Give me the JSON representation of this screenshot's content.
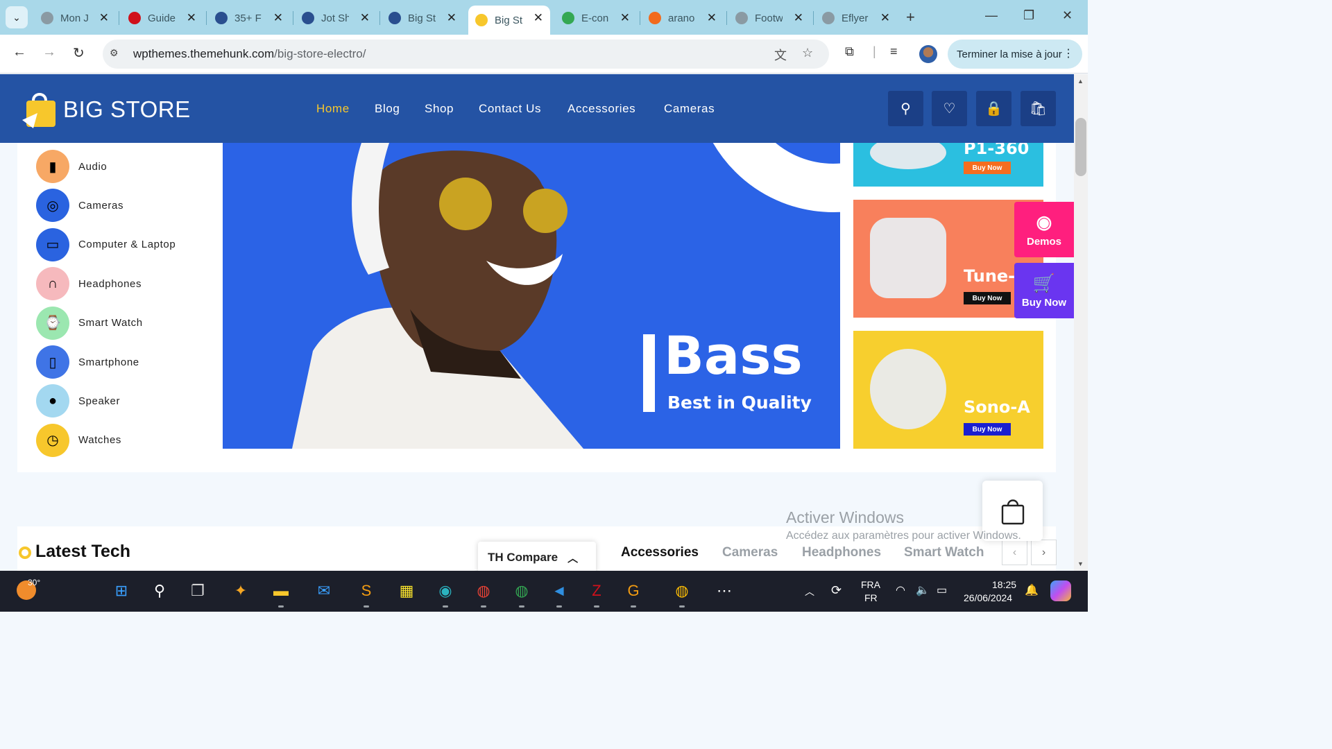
{
  "browser": {
    "tabs": [
      {
        "title": "Mon J",
        "icon": "globe-icon",
        "color": "#8a9aa3"
      },
      {
        "title": "Guide",
        "icon": "opera-icon",
        "color": "#d0111b"
      },
      {
        "title": "35+ F",
        "icon": "themehunk-icon",
        "color": "#2a4f8f"
      },
      {
        "title": "Jot Sh",
        "icon": "themehunk-icon",
        "color": "#2a4f8f"
      },
      {
        "title": "Big St",
        "icon": "themehunk-icon",
        "color": "#2a4f8f"
      },
      {
        "title": "Big St",
        "icon": "bigstore-icon",
        "color": "#f7c72c",
        "active": true
      },
      {
        "title": "E-con",
        "icon": "leaf-icon",
        "color": "#34a853"
      },
      {
        "title": "arano",
        "icon": "spiral-icon",
        "color": "#f26b1d"
      },
      {
        "title": "Footw",
        "icon": "globe-icon",
        "color": "#8a9aa3"
      },
      {
        "title": "Eflyer",
        "icon": "globe-icon",
        "color": "#8a9aa3"
      }
    ],
    "url_host": "wpthemes.themehunk.com",
    "url_path": "/big-store-electro/",
    "update_label": "Terminer la mise à jour"
  },
  "site": {
    "logo": "BIG STORE",
    "menu": [
      "Home",
      "Blog",
      "Shop",
      "Contact Us",
      "Accessories",
      "Cameras"
    ],
    "categories": [
      {
        "label": "Audio",
        "icon": "speaker-tower-icon",
        "bg": "#f7a865"
      },
      {
        "label": "Cameras",
        "icon": "camera-icon",
        "bg": "#2a63e0"
      },
      {
        "label": "Computer & Laptop",
        "icon": "laptop-icon",
        "bg": "#2a63e0"
      },
      {
        "label": "Headphones",
        "icon": "headphones-icon",
        "bg": "#f6b9bd"
      },
      {
        "label": "Smart Watch",
        "icon": "smartwatch-icon",
        "bg": "#9be7b0"
      },
      {
        "label": "Smartphone",
        "icon": "smartphone-icon",
        "bg": "#3f74e6"
      },
      {
        "label": "Speaker",
        "icon": "speaker-icon",
        "bg": "#a3d8f0"
      },
      {
        "label": "Watches",
        "icon": "watch-icon",
        "bg": "#f7c72c"
      }
    ],
    "hero": {
      "headline": "Bass",
      "subline": "Best in Quality"
    },
    "side_banners": [
      {
        "name": "P1-360",
        "button": "Buy Now",
        "bg": "#2bbfe0",
        "btn_bg": "#f56d1f"
      },
      {
        "name": "Tune-",
        "button": "Buy Now",
        "bg": "#f8805c",
        "btn_bg": "#111111"
      },
      {
        "name": "Sono-A",
        "button": "Buy Now",
        "bg": "#f7cf2e",
        "btn_bg": "#1a1fd0"
      }
    ],
    "float_demos": "Demos",
    "float_buy": "Buy Now",
    "latest_title": "Latest Tech",
    "compare_label": "TH Compare",
    "product_tabs": [
      "Accessories",
      "Cameras",
      "Headphones",
      "Smart Watch"
    ],
    "activate_title": "Activer Windows",
    "activate_sub": "Accédez aux paramètres pour activer Windows."
  },
  "taskbar": {
    "temperature": "30°",
    "lang_top": "FRA",
    "lang_bottom": "FR",
    "time": "18:25",
    "date": "26/06/2024"
  }
}
